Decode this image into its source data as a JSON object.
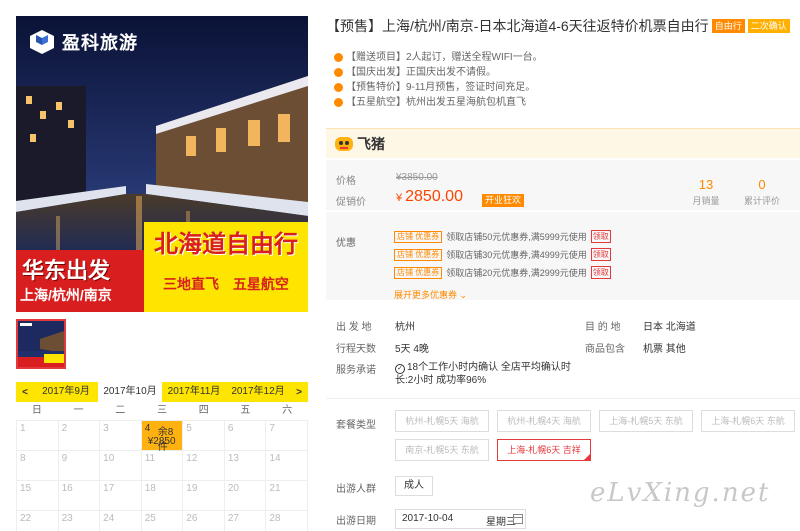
{
  "hero": {
    "brand": "盈科旅游",
    "band_left_title": "华东出发",
    "band_left_sub": "上海/杭州/南京",
    "band_right_title": "北海道自由行",
    "band_right_sub": "三地直飞 五星航空"
  },
  "calendar": {
    "prev": "<",
    "next": ">",
    "months": [
      "2017年9月",
      "2017年10月",
      "2017年11月",
      "2017年12月"
    ],
    "active_month_index": 1,
    "weekdays": [
      "日",
      "一",
      "二",
      "三",
      "四",
      "五",
      "六"
    ],
    "cells": [
      {
        "day": "1"
      },
      {
        "day": "2"
      },
      {
        "day": "3"
      },
      {
        "day": "4",
        "stock": "余8件",
        "price": "¥2850",
        "on": true
      },
      {
        "day": "5"
      },
      {
        "day": "6"
      },
      {
        "day": "7"
      },
      {
        "day": "8"
      },
      {
        "day": "9"
      },
      {
        "day": "10"
      },
      {
        "day": "11"
      },
      {
        "day": "12"
      },
      {
        "day": "13"
      },
      {
        "day": "14"
      },
      {
        "day": "15"
      },
      {
        "day": "16"
      },
      {
        "day": "17"
      },
      {
        "day": "18"
      },
      {
        "day": "19"
      },
      {
        "day": "20"
      },
      {
        "day": "21"
      },
      {
        "day": "22"
      },
      {
        "day": "23"
      },
      {
        "day": "24"
      },
      {
        "day": "25"
      },
      {
        "day": "26"
      },
      {
        "day": "27"
      },
      {
        "day": "28"
      }
    ]
  },
  "product": {
    "title": "【预售】上海/杭州/南京-日本北海道4-6天往返特价机票自由行",
    "tag1": "自由行",
    "tag2": "二次确认",
    "notes": [
      "【赠送项目】2人起订，赠送全程WIFI一台。",
      "【国庆出发】正国庆出发不请假。",
      "【预售特价】9-11月预售，签证时间充足。",
      "【五星航空】杭州出发五星海航包机直飞"
    ]
  },
  "platform": {
    "name": "飞猪"
  },
  "price": {
    "original_label": "价格",
    "original": "¥3850.00",
    "promo_label": "促销价",
    "currency": "¥",
    "promo": "2850.00",
    "badge": "开业狂欢",
    "monthly_sales_value": "13",
    "monthly_sales_label": "月销量",
    "reviews_value": "0",
    "reviews_label": "累计评价"
  },
  "coupons": {
    "label": "优惠",
    "tag": "店铺 优惠券",
    "items": [
      {
        "text": "领取店铺50元优惠券,满5999元使用",
        "action": "领取"
      },
      {
        "text": "领取店铺30元优惠券,满4999元使用",
        "action": "领取"
      },
      {
        "text": "领取店铺20元优惠券,满2999元使用",
        "action": "领取"
      }
    ],
    "more": "展开更多优惠券 ⌄"
  },
  "specs": {
    "depart_label": "出 发 地",
    "depart_value": "杭州",
    "dest_label": "目 的 地",
    "dest_value": "日本  北海道",
    "days_label": "行程天数",
    "days_value": "5天  4晚",
    "includes_label": "商品包含",
    "includes_value": "机票  其他",
    "commit_label": "服务承诺",
    "commit_line1": "18个工作小时内确认  全店平均确认时",
    "commit_line2": "长:2小时  成功率96%"
  },
  "packages": {
    "label": "套餐类型",
    "items": [
      {
        "text": "杭州-札幌5天 海航",
        "selected": false
      },
      {
        "text": "杭州-札幌4天 海航",
        "selected": false
      },
      {
        "text": "上海-札幌5天 东航",
        "selected": false
      },
      {
        "text": "上海-札幌6天 东航",
        "selected": false
      },
      {
        "text": "南京-札幌5天 东航",
        "selected": false
      },
      {
        "text": "上海-札幌6天 吉祥",
        "selected": true
      }
    ]
  },
  "travelers": {
    "label": "出游人群",
    "value": "成人"
  },
  "trip_date": {
    "label": "出游日期",
    "value": "2017-10-04",
    "weekday": "星期三"
  },
  "watermark": "eLvXing.net",
  "colors": {
    "accent": "#ff8a00",
    "price": "#ff4400",
    "select": "#e4393c",
    "calendar": "#fde500"
  }
}
